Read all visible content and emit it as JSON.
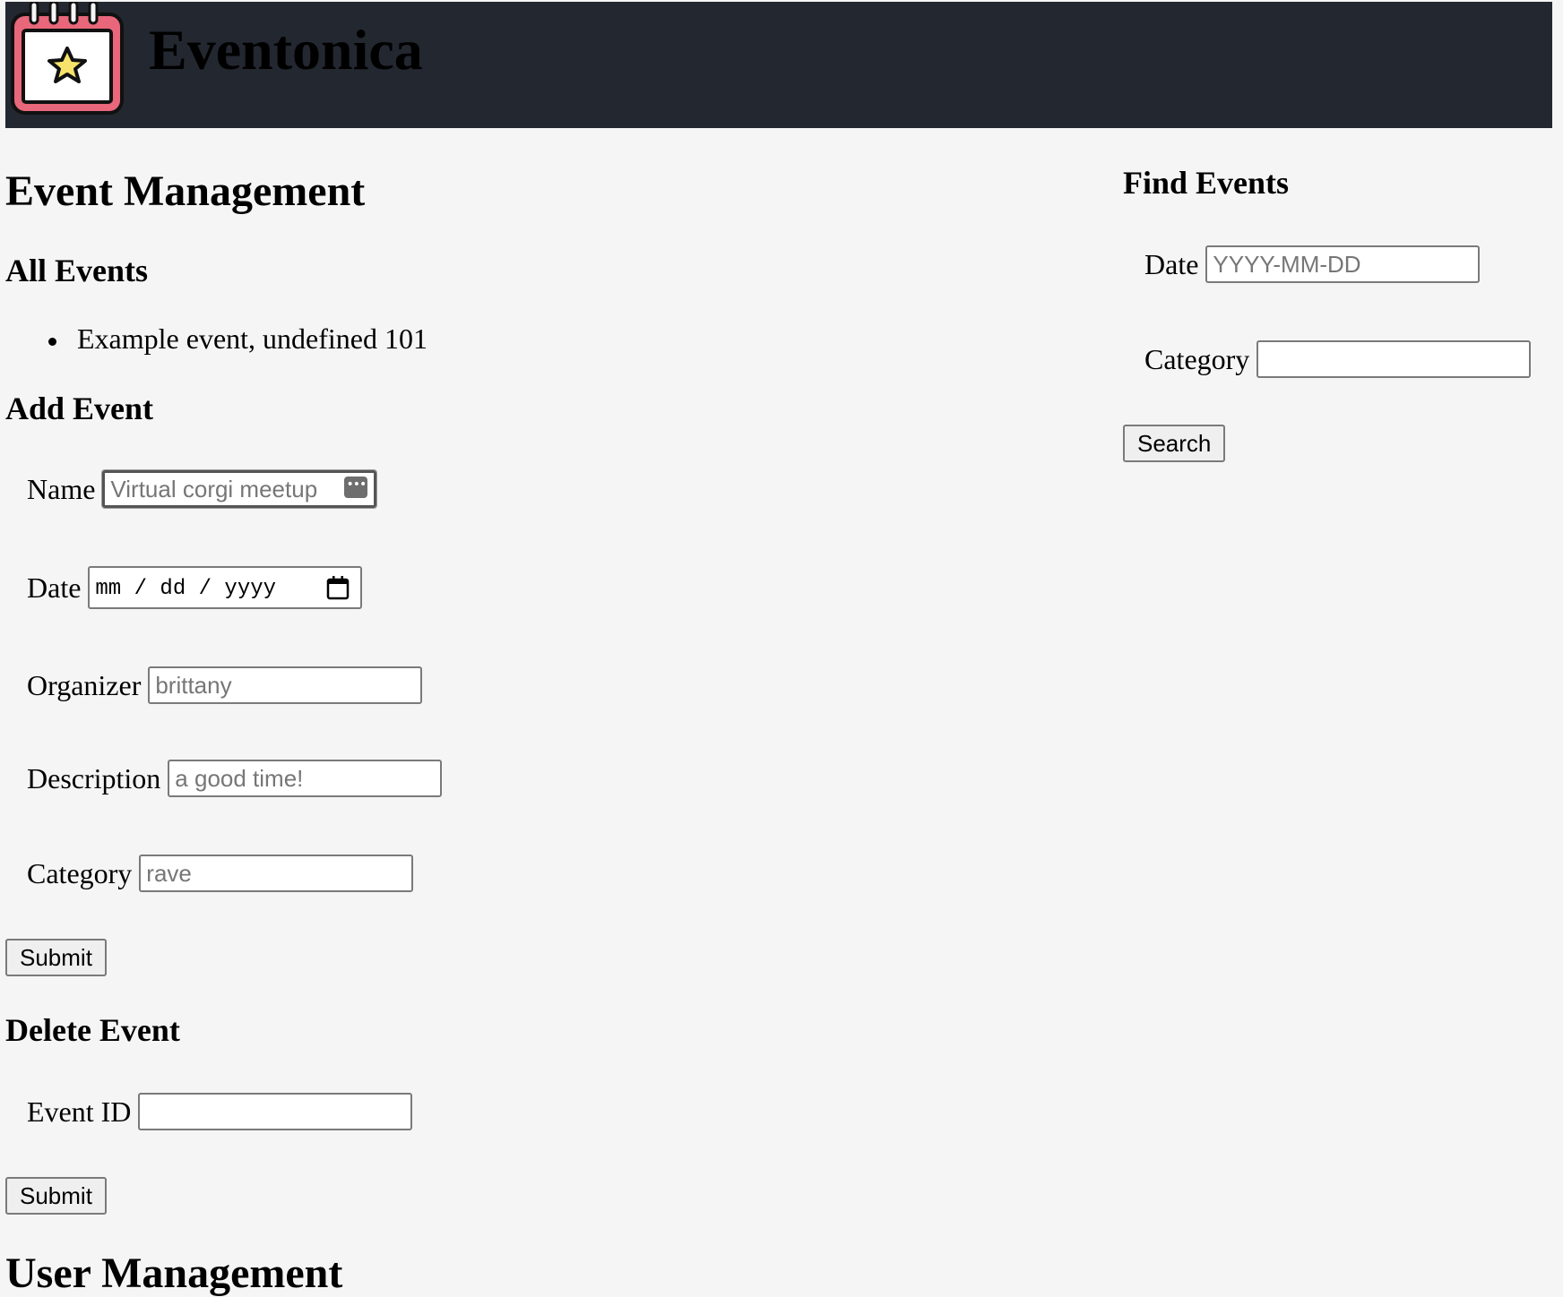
{
  "header": {
    "brand": "Eventonica"
  },
  "event_management": {
    "title": "Event Management",
    "all_events": {
      "title": "All Events",
      "items": [
        "Example event, undefined 101"
      ]
    },
    "add_event": {
      "title": "Add Event",
      "name_label": "Name",
      "name_placeholder": "Virtual corgi meetup",
      "date_label": "Date",
      "date_placeholder": "mm / dd / yyyy",
      "organizer_label": "Organizer",
      "organizer_placeholder": "brittany",
      "description_label": "Description",
      "description_placeholder": "a good time!",
      "category_label": "Category",
      "category_placeholder": "rave",
      "submit_label": "Submit"
    },
    "delete_event": {
      "title": "Delete Event",
      "event_id_label": "Event ID",
      "submit_label": "Submit"
    }
  },
  "find_events": {
    "title": "Find Events",
    "date_label": "Date",
    "date_placeholder": "YYYY-MM-DD",
    "category_label": "Category",
    "search_label": "Search"
  },
  "user_management": {
    "title": "User Management"
  },
  "colors": {
    "header_bg": "#232730",
    "page_bg": "#f5f5f5",
    "logo_red": "#e8677a",
    "logo_star": "#f7e36b"
  }
}
